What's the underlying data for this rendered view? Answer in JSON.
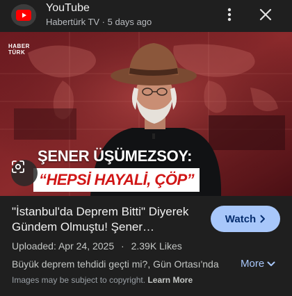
{
  "header": {
    "app_name": "YouTube",
    "subtitle": "Habertürk TV · 5 days ago"
  },
  "thumbnail": {
    "channel_logo_line1": "HABER",
    "channel_logo_line2": "TÜRK",
    "caption_name": "ŞENER ÜŞÜMEZSOY:",
    "caption_quote": "“HEPSİ HAYALİ, ÇÖP”"
  },
  "video": {
    "title": "\"İstanbul'da Deprem Bitti\" Diyerek Gündem Olmuştu! Şener Üşümezsoy",
    "watch_label": "Watch",
    "uploaded": "Uploaded: Apr 24, 2025",
    "separator": "·",
    "likes": "2.39K Likes",
    "description": "Büyük deprem tehdidi geçti mi?, Gün Ortası'nda",
    "more_label": "More"
  },
  "footer": {
    "notice": "Images may be subject to copyright.",
    "learn_more": "Learn More"
  },
  "colors": {
    "background": "#1f1f1f",
    "accent": "#a8c7fa",
    "youtube_red": "#ff0000",
    "quote_red": "#d01616"
  },
  "icons": [
    "youtube-logo-icon",
    "more-vert-icon",
    "close-icon",
    "lens-icon",
    "chevron-right-icon",
    "chevron-down-icon"
  ]
}
